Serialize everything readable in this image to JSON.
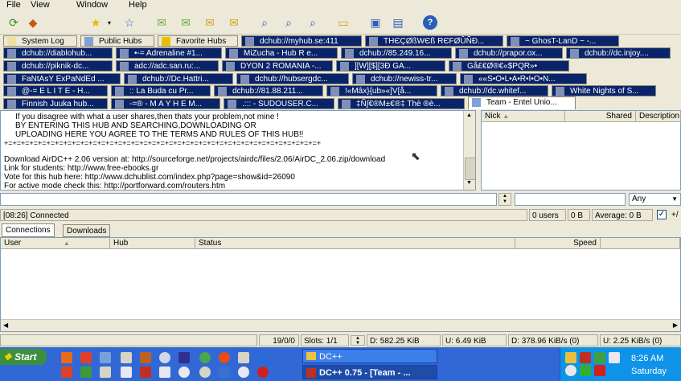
{
  "menu": [
    "File",
    "View",
    "Window",
    "Help"
  ],
  "toolbar_icons": [
    "refresh-icon",
    "reconnect-icon",
    "favorites-star-icon",
    "dropdown-icon",
    "add-favorite-icon",
    "queue-icon",
    "finished-icon",
    "upload-queue-icon",
    "search-spy-icon",
    "search-icon",
    "adl-search-icon",
    "search-alt-icon",
    "open-folder-icon",
    "settings-icon",
    "notepad-icon",
    "help-icon"
  ],
  "tabs": [
    {
      "label": "System Log",
      "style": "light"
    },
    {
      "label": "Public Hubs",
      "style": "light"
    },
    {
      "label": "Favorite Hubs",
      "style": "light"
    },
    {
      "label": "dchub://myhub.se:411",
      "style": "dark"
    },
    {
      "label": "THЄÇØßWЄß RЄFØÛÑĐ...",
      "style": "dark"
    },
    {
      "label": "~ GhosT-LanD ~ -...",
      "style": "dark"
    },
    {
      "label": "dchub://diablohub...",
      "style": "dark"
    },
    {
      "label": "•-= Adrenaline #1...",
      "style": "dark"
    },
    {
      "label": "MiZucha - Hub R e...",
      "style": "dark"
    },
    {
      "label": "dchub://85.249.16...",
      "style": "dark"
    },
    {
      "label": "dchub://prapor.ox...",
      "style": "dark"
    },
    {
      "label": "dchub://dc.injoy....",
      "style": "dark"
    },
    {
      "label": "dchub://piknik-dc...",
      "style": "dark"
    },
    {
      "label": "adc://adc.san.ru:...",
      "style": "dark"
    },
    {
      "label": "DYON 2 ROMANIA -...",
      "style": "dark"
    },
    {
      "label": "][W][$][3Đ GA...",
      "style": "dark"
    },
    {
      "label": "Gå£€Ø®€«$PQR»•",
      "style": "dark"
    },
    {
      "label": "FaNtAsY ExPaNdEd ...",
      "style": "dark"
    },
    {
      "label": "dchub://Dc.Hattri...",
      "style": "dark"
    },
    {
      "label": "dchub://hubsergdc...",
      "style": "dark"
    },
    {
      "label": "dchub://newiss-tr...",
      "style": "dark"
    },
    {
      "label": "««S•O•L•A•R•I•O•N...",
      "style": "dark"
    },
    {
      "label": "@-= E L I T E - H...",
      "style": "dark"
    },
    {
      "label": ":: La Buda cu Pr...",
      "style": "dark"
    },
    {
      "label": "dchub://81.88.211...",
      "style": "dark"
    },
    {
      "label": "!«Mâx}{ub»«]V[å...",
      "style": "dark"
    },
    {
      "label": "dchub://dc.whitef...",
      "style": "dark"
    },
    {
      "label": "White Nights of S...",
      "style": "dark"
    },
    {
      "label": "Finnish Juuka hub...",
      "style": "dark"
    },
    {
      "label": "-=® - M A Y H E M...",
      "style": "dark"
    },
    {
      "label": ".::: - SUDOUSER.C...",
      "style": "dark"
    },
    {
      "label": "‡Ñ∫€®M±€®‡ Thè ®è...",
      "style": "dark"
    },
    {
      "label": "Team - Entel Unio...",
      "style": "active"
    }
  ],
  "chat_lines": [
    "If you disagree with what a user shares,then thats your problem,not mine !",
    "BY ENTERING THIS HUB AND SEARCHING,DOWNLOADING OR",
    "UPLOADING HERE YOU AGREE TO THE TERMS AND RULES OF THIS HUB!!",
    "+=+=+=+=+=+=+=+=+=+=+=+=+=+=+=+=+=+=+=+=+=+=+=+=+=+=+=+=+=+=+=+=+=+=+=+=+=+",
    "",
    "Download AirDC++ 2.06 version at: http://sourceforge.net/projects/airdc/files/2.06/AirDC_2.06.zip/download",
    "Link for students: http://www.free-ebooks.gr",
    "Vote for this hub here: http://www.dchublist.com/index.php?page=show&id=26090",
    "For active mode check this: http://portforward.com/routers.htm"
  ],
  "user_columns": [
    "Nick",
    "Shared",
    "Description"
  ],
  "search_filter": {
    "value": "Any"
  },
  "status_bar": {
    "message": "[08:26] Connected",
    "users": "0 users",
    "shared": "0 B",
    "average": "Average: 0 B",
    "extra": "+/"
  },
  "bottom_tabs": [
    "Connections",
    "Downloads"
  ],
  "transfer_columns": [
    "User",
    "Hub",
    "Status",
    "Speed"
  ],
  "bottom_status": {
    "count": "19/0/0",
    "slots": "Slots: 1/1",
    "download": "D: 582.25 KiB",
    "upload": "U: 6.49 KiB",
    "dl_speed": "D: 378.96 KiB/s (0)",
    "ul_speed": "U: 2.25 KiB/s (0)"
  },
  "taskbar": {
    "start": "Start",
    "task1": "DC++",
    "task2": "DC++ 0.75 - [Team - ...",
    "time": "8:26 AM",
    "day": "Saturday"
  }
}
